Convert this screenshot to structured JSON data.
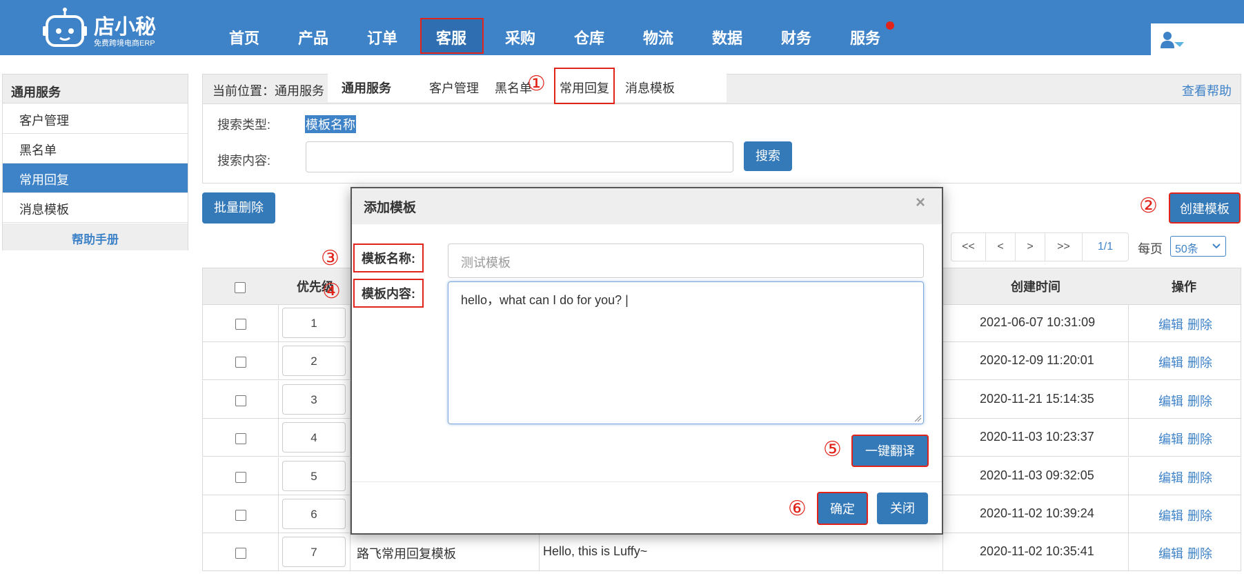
{
  "brand": {
    "name": "店小秘",
    "tagline": "免费跨境电商ERP"
  },
  "nav": {
    "items": [
      "首页",
      "产品",
      "订单",
      "客服",
      "采购",
      "仓库",
      "物流",
      "数据",
      "财务",
      "服务"
    ],
    "active": "客服"
  },
  "sidebar": {
    "title": "通用服务",
    "items": [
      "客户管理",
      "黑名单",
      "常用回复",
      "消息模板"
    ],
    "active": "常用回复",
    "help": "帮助手册"
  },
  "breadcrumb": {
    "text": "当前位置：通用服务 >",
    "help_link": "查看帮助"
  },
  "submenu": {
    "title": "通用服务",
    "items": [
      "客户管理",
      "黑名单",
      "常用回复",
      "消息模板"
    ],
    "active": "常用回复"
  },
  "search": {
    "type_label": "搜索类型:",
    "type_value": "模板名称",
    "content_label": "搜索内容:",
    "content_value": "",
    "button": "搜索"
  },
  "toolbar": {
    "batch_delete": "批量删除",
    "create": "创建模板"
  },
  "pagination": {
    "first": "<<",
    "prev": "<",
    "next": ">",
    "last": ">>",
    "page": "1/1",
    "per_page_label": "每页",
    "per_page_value": "50条"
  },
  "table": {
    "headers": {
      "priority": "优先级",
      "created": "创建时间",
      "actions": "操作"
    },
    "rows": [
      {
        "priority": "1",
        "name": "",
        "content": "",
        "created": "2021-06-07 10:31:09"
      },
      {
        "priority": "2",
        "name": "",
        "content": "",
        "created": "2020-12-09 11:20:01"
      },
      {
        "priority": "3",
        "name": "",
        "content": "",
        "created": "2020-11-21 15:14:35"
      },
      {
        "priority": "4",
        "name": "",
        "content": "",
        "created": "2020-11-03 10:23:37"
      },
      {
        "priority": "5",
        "name": "",
        "content": "",
        "created": "2020-11-03 09:32:05"
      },
      {
        "priority": "6",
        "name": "",
        "content": "",
        "created": "2020-11-02 10:39:24"
      },
      {
        "priority": "7",
        "name": "路飞常用回复模板",
        "content": "Hello, this is Luffy~",
        "created": "2020-11-02 10:35:41"
      }
    ],
    "edit": "编辑",
    "delete": "删除"
  },
  "modal": {
    "title": "添加模板",
    "close": "×",
    "name_label": "模板名称:",
    "name_placeholder": "测试模板",
    "content_label": "模板内容:",
    "content_value": "hello，what can I do for you? |",
    "translate": "一键翻译",
    "ok": "确定",
    "cancel": "关闭"
  },
  "steps": [
    "①",
    "②",
    "③",
    "④",
    "⑤",
    "⑥"
  ],
  "colors": {
    "primary": "#3e82c8",
    "highlight": "#e2231a"
  }
}
